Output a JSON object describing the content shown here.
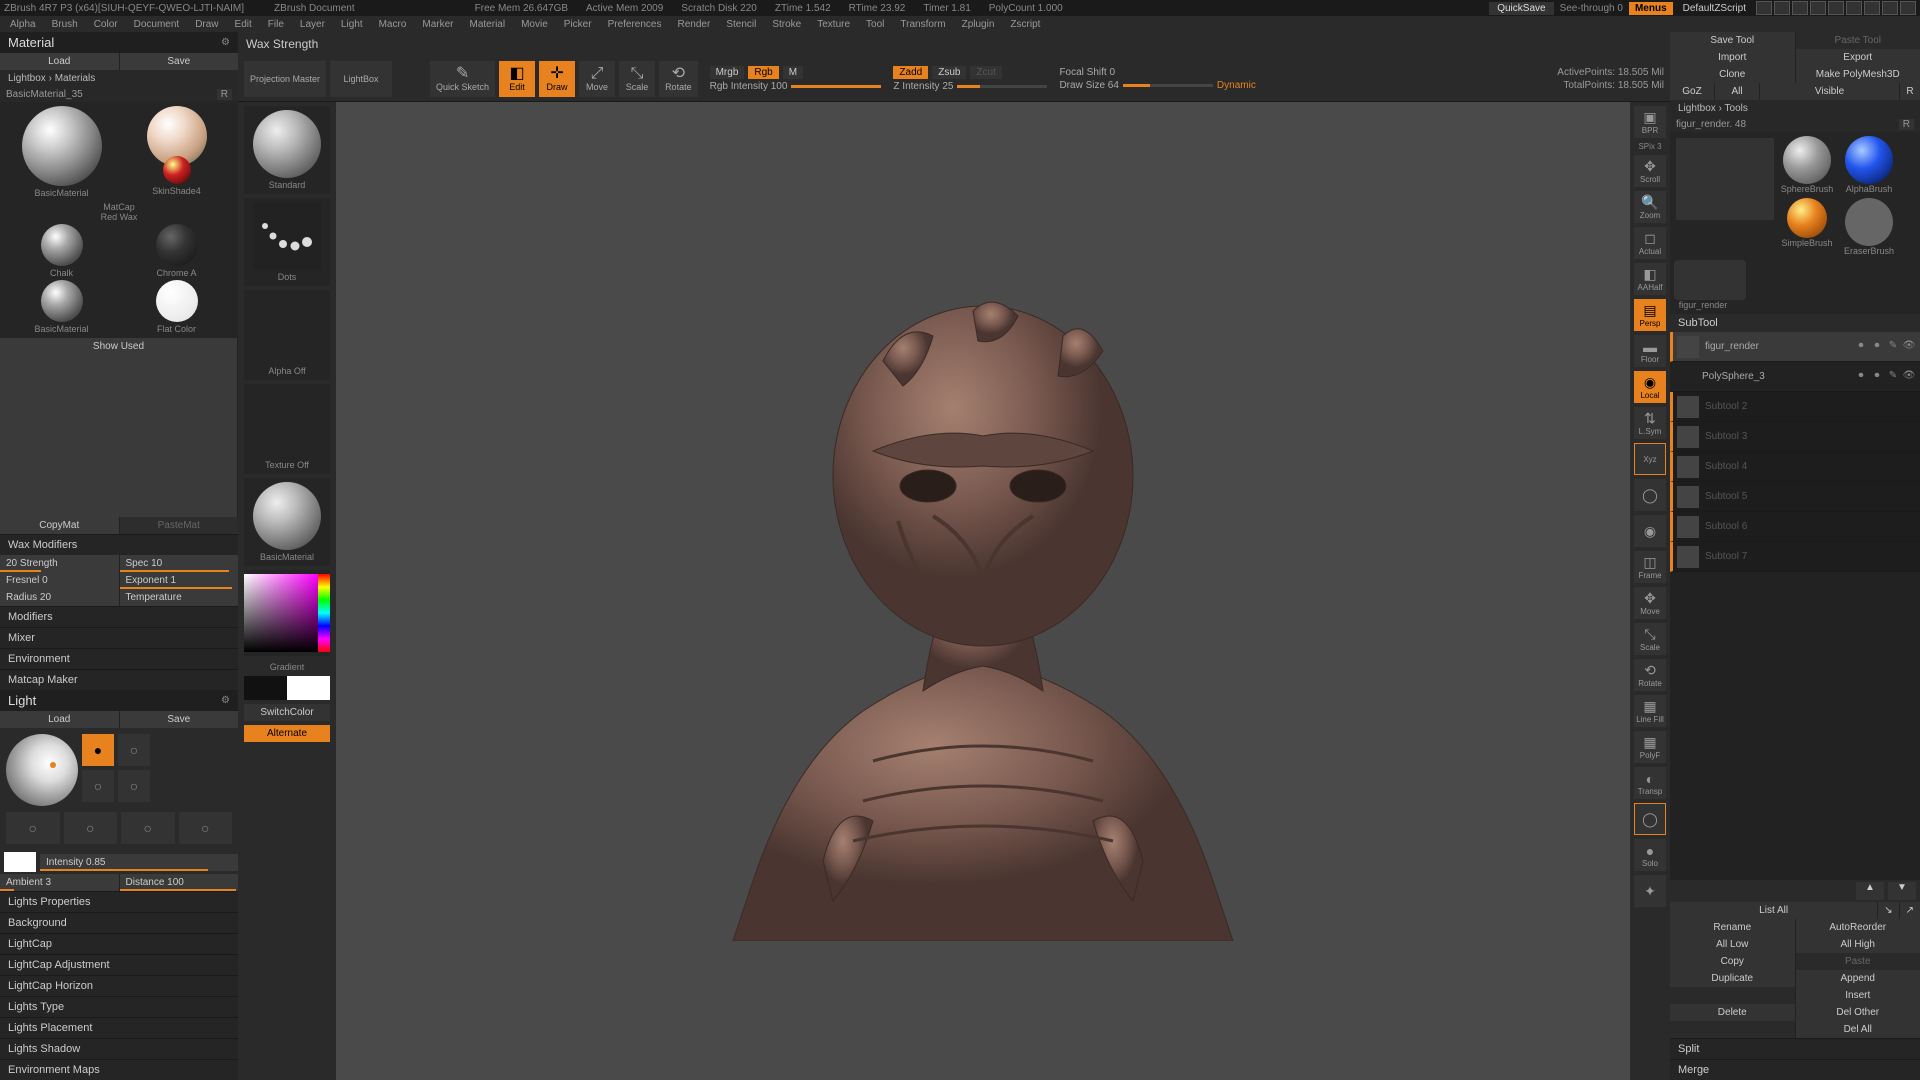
{
  "titlebar": {
    "app": "ZBrush 4R7 P3  (x64)[SIUH-QEYF-QWEO-LJTI-NAIM]",
    "doc": "ZBrush Document",
    "stats": [
      "Free Mem 26.647GB",
      "Active Mem 2009",
      "Scratch Disk 220",
      "ZTime 1.542",
      "RTime 23.92",
      "Timer 1.81",
      "PolyCount 1.000"
    ],
    "quicksave": "QuickSave",
    "seethru": "See-through  0",
    "menus": "Menus",
    "script": "DefaultZScript"
  },
  "menubar": [
    "Alpha",
    "Brush",
    "Color",
    "Document",
    "Draw",
    "Edit",
    "File",
    "Layer",
    "Light",
    "Macro",
    "Marker",
    "Material",
    "Movie",
    "Picker",
    "Preferences",
    "Render",
    "Stencil",
    "Stroke",
    "Texture",
    "Tool",
    "Transform",
    "Zplugin",
    "Zscript"
  ],
  "material": {
    "title": "Material",
    "load": "Load",
    "save": "Save",
    "lightbox": "Lightbox › Materials",
    "basic": "BasicMaterial_35",
    "r": "R",
    "items": [
      {
        "name": "BasicMaterial"
      },
      {
        "name": "SkinShade4"
      },
      {
        "name": "Chalk"
      },
      {
        "name": "MatCap Red Wax"
      },
      {
        "name": "Chalk"
      },
      {
        "name": "Chrome A"
      },
      {
        "name": "BasicMaterial"
      },
      {
        "name": "Flat Color"
      }
    ],
    "show_used": "Show Used",
    "copymat": "CopyMat",
    "pastemat": "PasteMat",
    "wax_title": "Wax Modifiers",
    "wax": [
      [
        "20 Strength",
        "Spec 10"
      ],
      [
        "Fresnel 0",
        "Exponent 1"
      ],
      [
        "Radius 20",
        "Temperature"
      ]
    ],
    "sections": [
      "Modifiers",
      "Mixer",
      "Environment",
      "Matcap Maker"
    ]
  },
  "light": {
    "title": "Light",
    "load": "Load",
    "save": "Save",
    "intensity": "Intensity 0.85",
    "ambient": "Ambient 3",
    "distance": "Distance 100",
    "sections": [
      "Lights Properties",
      "Background",
      "LightCap",
      "LightCap Adjustment",
      "LightCap Horizon",
      "Lights Type",
      "Lights Placement",
      "Lights Shadow",
      "Environment Maps"
    ]
  },
  "tool_header": "Wax Strength",
  "toolbar": {
    "projection": "Projection Master",
    "lightbox": "LightBox",
    "quick_sketch": "Quick Sketch",
    "edit": "Edit",
    "draw": "Draw",
    "move": "Move",
    "scale": "Scale",
    "rotate": "Rotate",
    "mrgb": "Mrgb",
    "rgb": "Rgb",
    "m": "M",
    "rgb_int": "Rgb Intensity 100",
    "zadd": "Zadd",
    "zsub": "Zsub",
    "zcut": "Zcut",
    "z_int": "Z Intensity 25",
    "focal": "Focal Shift 0",
    "draw_size": "Draw Size 64",
    "dynamic": "Dynamic",
    "active": "ActivePoints: 18.505 Mil",
    "total": "TotalPoints: 18.505 Mil"
  },
  "shelf": {
    "standard": "Standard",
    "dots": "Dots",
    "alpha_off": "Alpha Off",
    "texture_off": "Texture Off",
    "basicmat": "BasicMaterial",
    "gradient": "Gradient",
    "switch": "SwitchColor",
    "alternate": "Alternate"
  },
  "right_shelf": [
    "BPR",
    "SPix 3",
    "Scroll",
    "Zoom",
    "Actual",
    "AAHalf",
    "Persp",
    "Floor",
    "Local",
    "L.Sym",
    "Xyz",
    "",
    "",
    "Frame",
    "Move",
    "Scale",
    "Rotate",
    "Line Fill",
    "PolyF",
    "Transp",
    "Ghost",
    "Solo",
    "Xpose"
  ],
  "right": {
    "save_tool": "Save Tool",
    "paste": "Paste Tool",
    "import": "Import",
    "export": "Export",
    "clone": "Clone",
    "polymesh": "Make PolyMesh3D",
    "goz": "GoZ",
    "all": "All",
    "visible": "Visible",
    "r": "R",
    "lightbox": "Lightbox › Tools",
    "current": "figur_render. 48",
    "thumbs": [
      {
        "name": "figur_render_",
        "cls": "big"
      },
      {
        "name": "SphereBrush",
        "cls": "sphere"
      },
      {
        "name": "AlphaBrush",
        "cls": "alpha"
      },
      {
        "name": "SimpleBrush",
        "cls": "gold"
      },
      {
        "name": "EraserBrush",
        "cls": "blue"
      },
      {
        "name": "figur_render",
        "cls": "alpha"
      }
    ],
    "subtool": "SubTool",
    "subtools": [
      {
        "name": "figur_render",
        "sel": true
      },
      {
        "name": "PolySphere_3"
      },
      {
        "name": "Subtool 2",
        "dim": true
      },
      {
        "name": "Subtool 3",
        "dim": true
      },
      {
        "name": "Subtool 4",
        "dim": true
      },
      {
        "name": "Subtool 5",
        "dim": true
      },
      {
        "name": "Subtool 6",
        "dim": true
      },
      {
        "name": "Subtool 7",
        "dim": true
      }
    ],
    "list_all": "List All",
    "ops": [
      [
        "Rename",
        "AutoReorder"
      ],
      [
        "All Low",
        "All High"
      ],
      [
        "Copy",
        "Paste"
      ],
      [
        "Duplicate",
        "Append"
      ],
      [
        "",
        "Insert"
      ],
      [
        "Delete",
        "Del Other"
      ],
      [
        "",
        "Del All"
      ],
      [
        "Split",
        ""
      ],
      [
        "Merge",
        ""
      ]
    ]
  }
}
